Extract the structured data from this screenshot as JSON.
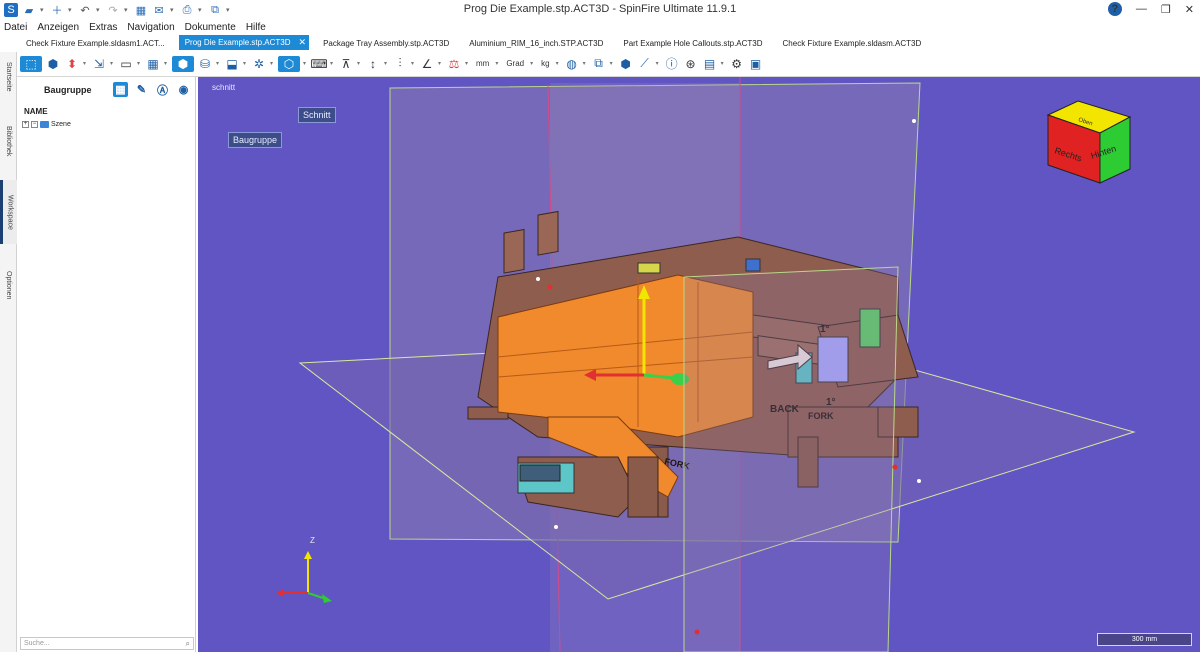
{
  "window": {
    "title": "Prog Die Example.stp.ACT3D - SpinFire Ultimate 11.9.1"
  },
  "menu": [
    "Datei",
    "Anzeigen",
    "Extras",
    "Navigation",
    "Dokumente",
    "Hilfe"
  ],
  "tabs": [
    "Check Fixture Example.sldasm1.ACT...",
    "Prog Die Example.stp.ACT3D",
    "Package Tray Assembly.stp.ACT3D",
    "Aluminium_RIM_16_inch.STP.ACT3D",
    "Part Example Hole Callouts.stp.ACT3D",
    "Check Fixture Example.sldasm.ACT3D"
  ],
  "toolbar": {
    "unit_length": "mm",
    "unit_angle": "Grad",
    "unit_mass": "kg"
  },
  "sidebar": {
    "tabs": [
      "Startseite",
      "Bibliothek",
      "Workspace",
      "Optionen"
    ]
  },
  "panel": {
    "title": "Baugruppe",
    "column": "NAME",
    "tree_root": "Szene",
    "search_placeholder": "Suche..."
  },
  "viewport": {
    "corner_label": "schnitt",
    "btn_schnitt": "Schnitt",
    "btn_baugruppe": "Baugruppe",
    "cube": {
      "top": "Oben",
      "left": "Rechts",
      "right": "Hinten"
    },
    "model_labels": {
      "back": "BACK",
      "fork": "FORK",
      "fork_front": "FORK",
      "num": "1°",
      "num2": "1°"
    },
    "axes": {
      "z": "Z"
    },
    "scale": "300 mm",
    "colors": {
      "background": "#6155c4",
      "section_orange": "#f08a2c",
      "part_brown": "#8f5d4e"
    }
  }
}
